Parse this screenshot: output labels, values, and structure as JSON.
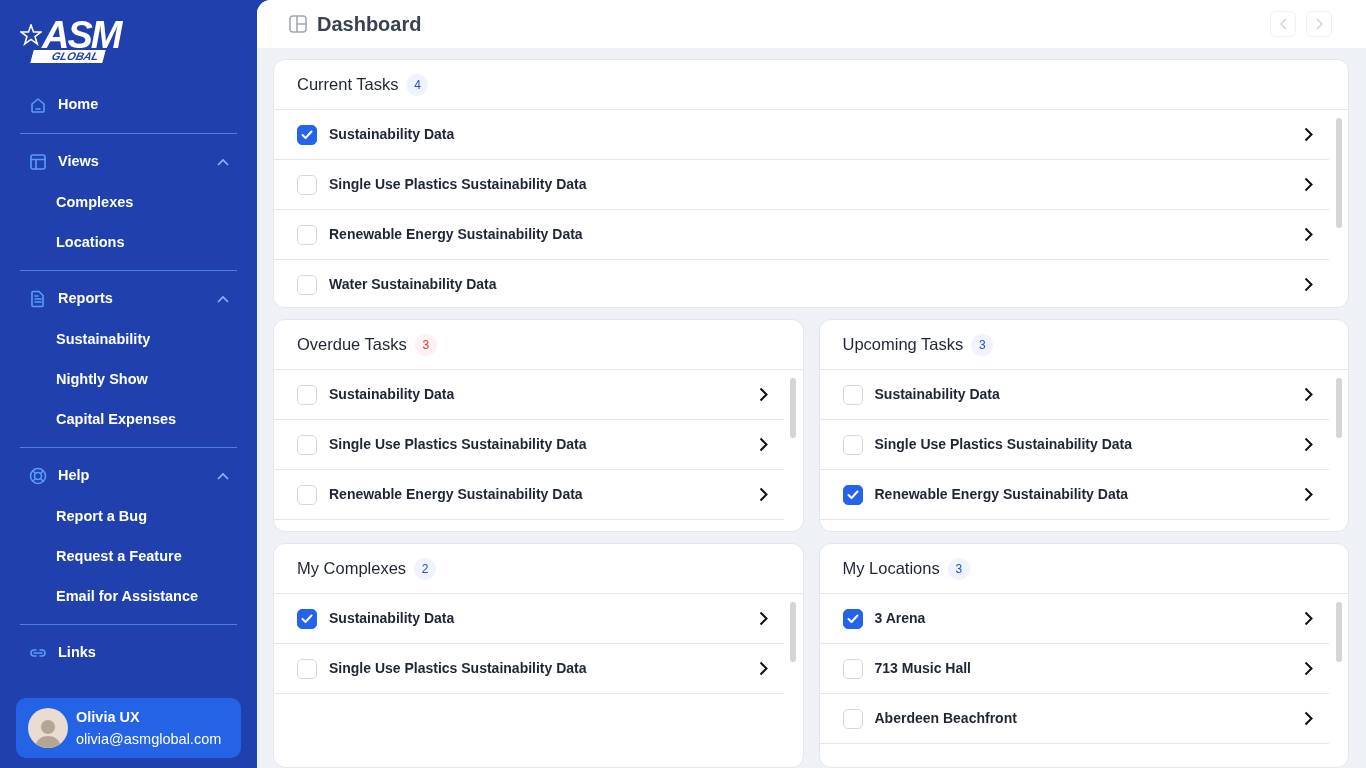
{
  "sidebar": {
    "logo": {
      "main": "ASM",
      "sub": "GLOBAL"
    },
    "sections": [
      {
        "label": "Home"
      },
      {
        "label": "Views",
        "expanded": true,
        "children": [
          {
            "label": "Complexes"
          },
          {
            "label": "Locations"
          }
        ]
      },
      {
        "label": "Reports",
        "expanded": true,
        "children": [
          {
            "label": "Sustainability"
          },
          {
            "label": "Nightly Show"
          },
          {
            "label": "Capital Expenses"
          }
        ]
      },
      {
        "label": "Help",
        "expanded": true,
        "children": [
          {
            "label": "Report a Bug"
          },
          {
            "label": "Request a Feature"
          },
          {
            "label": "Email for Assistance"
          }
        ]
      },
      {
        "label": "Links"
      }
    ],
    "user": {
      "name": "Olivia UX",
      "email": "olivia@asmglobal.com"
    }
  },
  "header": {
    "title": "Dashboard",
    "nav_buttons": [
      {
        "kind": "prev",
        "disabled": true
      },
      {
        "kind": "next",
        "disabled": true
      }
    ]
  },
  "panels": [
    {
      "title": "Current Tasks",
      "count": "4",
      "color": "#2150d6",
      "items": [
        {
          "label": "Sustainability Data",
          "checked": true
        },
        {
          "label": "Single Use Plastics Sustainability Data",
          "checked": false
        },
        {
          "label": "Renewable Energy Sustainability Data",
          "checked": false
        },
        {
          "label": "Water Sustainability Data",
          "checked": false
        }
      ]
    },
    {
      "title": "Overdue Tasks",
      "count": "3",
      "color": "#e53935",
      "items": [
        {
          "label": "Sustainability Data",
          "checked": false
        },
        {
          "label": "Single Use Plastics Sustainability Data",
          "checked": false
        },
        {
          "label": "Renewable Energy Sustainability Data",
          "checked": false
        }
      ]
    },
    {
      "title": "Upcoming Tasks",
      "count": "3",
      "color": "#2150d6",
      "items": [
        {
          "label": "Sustainability Data",
          "checked": false
        },
        {
          "label": "Single Use Plastics Sustainability Data",
          "checked": false
        },
        {
          "label": "Renewable Energy Sustainability Data",
          "checked": true
        }
      ]
    },
    {
      "title": "My Complexes",
      "count": "2",
      "color": "#2150d6",
      "items": [
        {
          "label": "Sustainability Data",
          "checked": true
        },
        {
          "label": "Single Use Plastics Sustainability Data",
          "checked": false
        }
      ]
    },
    {
      "title": "My Locations",
      "count": "3",
      "color": "#2150d6",
      "items": [
        {
          "label": "3 Arena",
          "checked": true
        },
        {
          "label": "713 Music Hall",
          "checked": false
        },
        {
          "label": "Aberdeen Beachfront",
          "checked": false
        }
      ]
    }
  ]
}
